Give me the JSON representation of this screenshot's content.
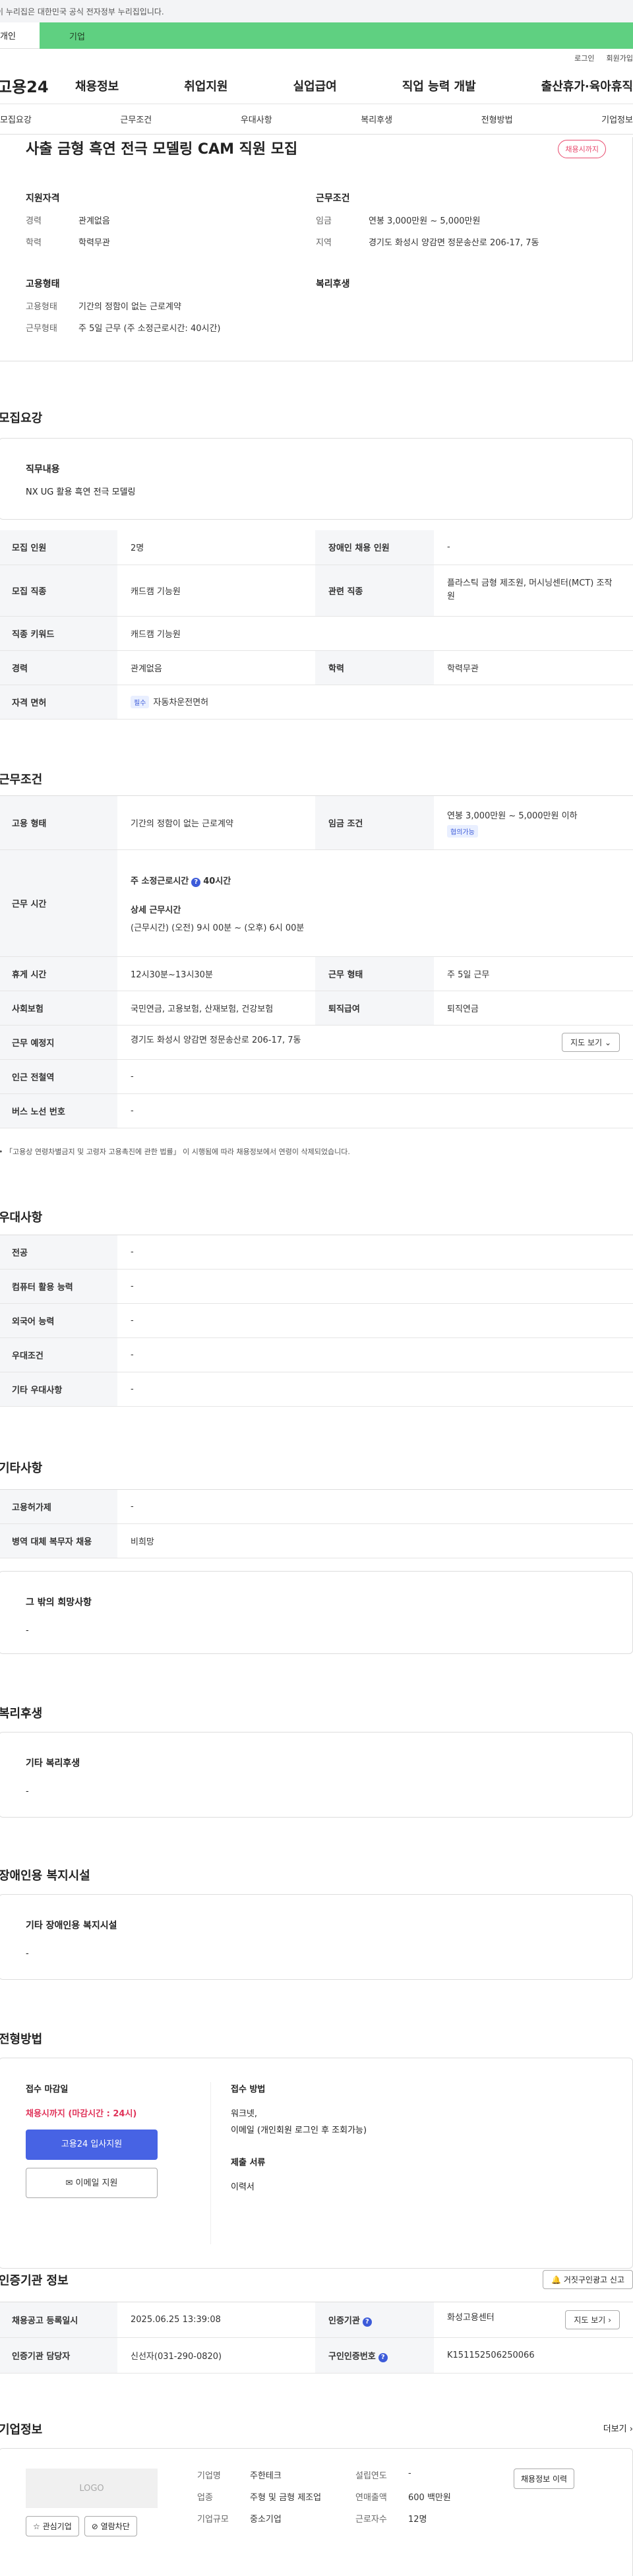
{
  "gov_strip": {
    "text": "이 누리집은 대한민국 공식 전자정부 누리집입니다."
  },
  "tabs": {
    "personal": "개인",
    "company": "기업"
  },
  "util": {
    "login": "로그인",
    "signup": "회원가입"
  },
  "nav": {
    "logo": "고용24",
    "items": [
      "채용정보",
      "취업지원",
      "실업급여",
      "직업 능력 개발",
      "출산휴가·육아휴직"
    ]
  },
  "subtabs": [
    "모집요강",
    "근무조건",
    "우대사항",
    "복리후생",
    "전형방법",
    "기업정보"
  ],
  "summary": {
    "title": "사출 금형 흑연 전극 모델링 CAM 직원 모집",
    "status": "채용시까지",
    "qual_title": "지원자격",
    "qual": [
      {
        "k": "경력",
        "v": "관계없음"
      },
      {
        "k": "학력",
        "v": "학력무관"
      }
    ],
    "cond_title": "근무조건",
    "cond": [
      {
        "k": "임금",
        "v": "연봉 3,000만원 ~ 5,000만원"
      },
      {
        "k": "지역",
        "v": "경기도 화성시 양감면 정문송산로 206-17, 7동"
      }
    ],
    "emp_title": "고용형태",
    "emp": [
      {
        "k": "고용형태",
        "v": "기간의 정함이 없는 근로계약"
      },
      {
        "k": "근무형태",
        "v": "주 5일 근무 (주 소정근로시간: 40시간)"
      }
    ],
    "welfare_title": "복리후생"
  },
  "recruit": {
    "title": "모집요강",
    "job_label": "직무내용",
    "job_value": "NX UG 활용 흑연 전극 모델링",
    "rows": {
      "headcount_k": "모집 인원",
      "headcount_v": "2명",
      "disabled_k": "장애인 채용 인원",
      "disabled_v": "-",
      "jobtype_k": "모집 직종",
      "jobtype_v": "캐드캠 기능원",
      "related_k": "관련 직종",
      "related_v": "플라스틱 금형 제조원, 머시닝센터(MCT) 조작원",
      "keyword_k": "직종 키워드",
      "keyword_v": "캐드캠 기능원",
      "career_k": "경력",
      "career_v": "관계없음",
      "edu_k": "학력",
      "edu_v": "학력무관",
      "license_k": "자격 면허",
      "license_badge": "필수",
      "license_v": "자동차운전면허"
    }
  },
  "work": {
    "title": "근무조건",
    "emp_k": "고용 형태",
    "emp_v": "기간의 정함이 없는 근로계약",
    "wage_k": "임금 조건",
    "wage_v": "연봉 3,000만원 ~ 5,000만원 이하",
    "wage_badge": "협의가능",
    "hours_k": "근무 시간",
    "hours_main": "주 소정근로시간",
    "hours_main_v": "40시간",
    "hours_detail_title": "상세 근무시간",
    "hours_detail": "(근무시간) (오전) 9시 00분 ~ (오후) 6시 00분",
    "break_k": "휴게 시간",
    "break_v": "12시30분~13시30분",
    "shift_k": "근무 형태",
    "shift_v": "주 5일 근무",
    "ins_k": "사회보험",
    "ins_v": "국민연금, 고용보험, 산재보험, 건강보험",
    "retire_k": "퇴직급여",
    "retire_v": "퇴직연금",
    "place_k": "근무 예정지",
    "place_v": "경기도 화성시 양감면 정문송산로 206-17, 7동",
    "map_btn": "지도 보기",
    "subway_k": "인근 전철역",
    "subway_v": "-",
    "bus_k": "버스 노선 번호",
    "bus_v": "-",
    "note": "「고용상 연령차별금지 및 고령자 고용촉진에 관한 법률」 이 시행됨에 따라 채용정보에서 연령이 삭제되었습니다."
  },
  "pref": {
    "title": "우대사항",
    "rows": [
      {
        "k": "전공",
        "v": "-"
      },
      {
        "k": "컴퓨터 활용 능력",
        "v": "-"
      },
      {
        "k": "외국어 능력",
        "v": "-"
      },
      {
        "k": "우대조건",
        "v": "-"
      },
      {
        "k": "기타 우대사항",
        "v": "-"
      }
    ]
  },
  "etc": {
    "title": "기타사항",
    "rows": [
      {
        "k": "고용허가제",
        "v": "-"
      },
      {
        "k": "병역 대체 복무자 채용",
        "v": "비희망"
      }
    ],
    "other_title": "그 밖의 희망사항",
    "other_value": "-"
  },
  "welfare": {
    "title": "복리후생",
    "sub": "기타 복리후생",
    "value": "-"
  },
  "disabled_fac": {
    "title": "장애인용 복지시설",
    "sub": "기타 장애인용 복지시설",
    "value": "-"
  },
  "process": {
    "title": "전형방법",
    "deadline_label": "접수 마감일",
    "deadline_value": "채용시까지 (마감시간 : 24시)",
    "apply_btn": "고용24 입사지원",
    "email_btn": "이메일 지원",
    "method_label": "접수 방법",
    "method_value1": "워크넷,",
    "method_value2": "이메일 (개인회원 로그인 후 조회가능)",
    "docs_label": "제출 서류",
    "docs_value": "이력서"
  },
  "cert": {
    "title": "인증기관 정보",
    "report_btn": "거짓구인광고 신고",
    "reg_k": "채용공고 등록일시",
    "reg_v": "2025.06.25 13:39:08",
    "org_k": "인증기관",
    "org_v": "화성고용센터",
    "map_btn": "지도 보기",
    "mgr_k": "인증기관 담당자",
    "mgr_v": "신선자(031-290-0820)",
    "num_k": "구인인증번호",
    "num_v": "K151152506250066"
  },
  "company": {
    "title": "기업정보",
    "more": "더보기",
    "logo": "LOGO",
    "fav_btn": "관심기업",
    "block_btn": "열람차단",
    "name_k": "기업명",
    "name_v": "주한테크",
    "industry_k": "업종",
    "industry_v": "주형 및 금형 제조업",
    "size_k": "기업규모",
    "size_v": "중소기업",
    "year_k": "설립연도",
    "year_v": "-",
    "sales_k": "연매출액",
    "sales_v": "600 백만원",
    "emp_k": "근로자수",
    "emp_v": "12명",
    "recruit_btn": "채용정보 이력"
  }
}
